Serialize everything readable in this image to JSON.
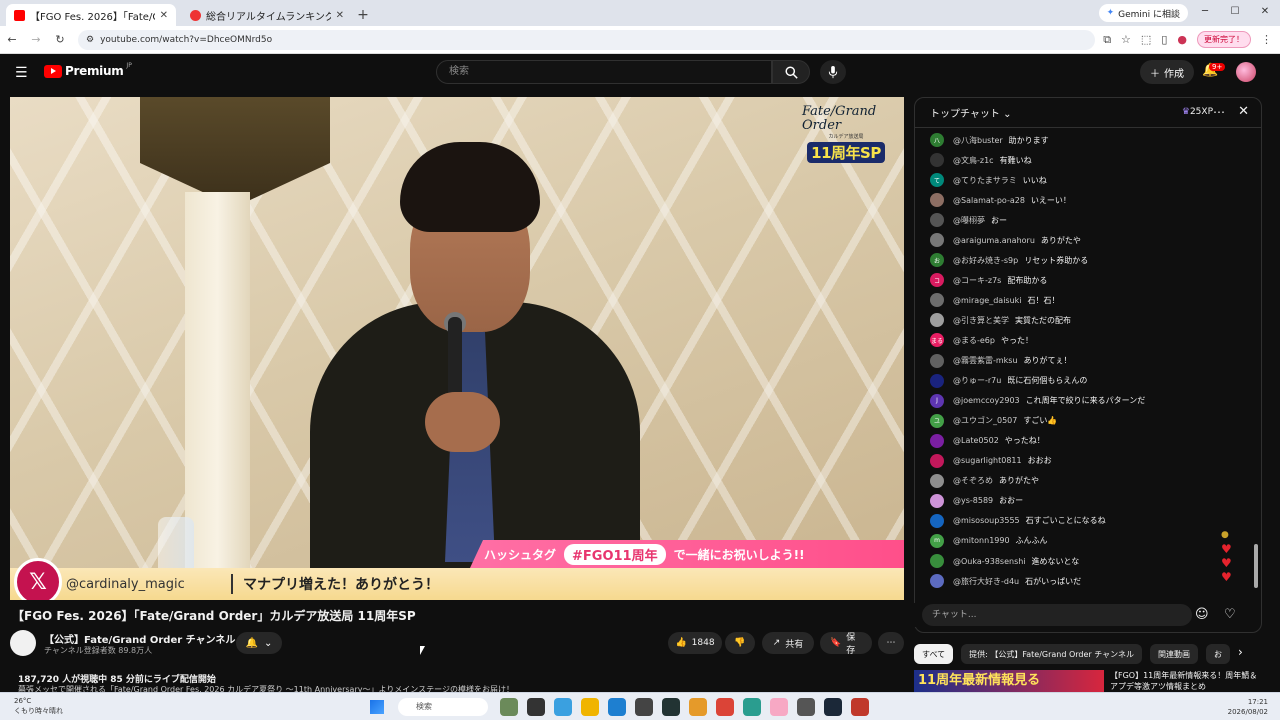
{
  "browser": {
    "tabs": [
      {
        "title": "【FGO Fes. 2026】「Fate/Gran",
        "active": true
      },
      {
        "title": "総合リアルタイムランキング | 配信ラ",
        "active": false
      }
    ],
    "gemini_label": "Gemini に相談",
    "url": "youtube.com/watch?v=DhceOMNrd5o",
    "restart_label": "更新完了！"
  },
  "youtube": {
    "logo_text": "Premium",
    "logo_region": "JP",
    "search_placeholder": "検索",
    "create_label": "作成",
    "notification_count": "9+"
  },
  "video": {
    "overlay_logo": {
      "line1": "Fate/Grand Order",
      "line2": "カルデア放送局",
      "line3": "11周年SP"
    },
    "hashtag_prefix": "ハッシュタグ",
    "hashtag": "#FGO11周年",
    "hashtag_suffix": "で一緒にお祝いしよう!!",
    "x_handle": "@cardinaly_magic",
    "x_message": "マナプリ増えた！ありがとう！"
  },
  "info": {
    "title": "【FGO Fes. 2026】「Fate/Grand Order」カルデア放送局 11周年SP",
    "channel_name": "【公式】Fate/Grand Order チャンネル",
    "subscribers": "チャンネル登録者数 89.8万人",
    "likes": "1848",
    "share_label": "共有",
    "save_label": "保存",
    "viewers": "187,720 人が視聴中  85 分前にライブ配信開始",
    "description": "幕張メッセで開催される「Fate/Grand Order Fes. 2026 カルデア夏祭り ～11th Anniversary～」よりメインステージの模様をお届け！"
  },
  "chat": {
    "header": "トップチャット",
    "xp": "25XP",
    "input_placeholder": "チャット...",
    "messages": [
      {
        "author": "@八海buster",
        "text": "助かります",
        "color": "#2e7d32",
        "initial": "八"
      },
      {
        "author": "@文鳥-z1c",
        "text": "有難いね",
        "color": "#333333",
        "initial": ""
      },
      {
        "author": "@てりたまサラミ",
        "text": "いいね",
        "color": "#00897b",
        "initial": "て"
      },
      {
        "author": "@Salamat-po-a28",
        "text": "いえーい！",
        "color": "#8d6e63",
        "initial": ""
      },
      {
        "author": "@曝栩夢",
        "text": "おー",
        "color": "#555555",
        "initial": ""
      },
      {
        "author": "@araiguma.anahoru",
        "text": "ありがたや",
        "color": "#777777",
        "initial": ""
      },
      {
        "author": "@お好み焼き-s9p",
        "text": "リセット券助かる",
        "color": "#2e7d32",
        "initial": "お"
      },
      {
        "author": "@コーキ-z7s",
        "text": "配布助かる",
        "color": "#d81b60",
        "initial": "コ"
      },
      {
        "author": "@mirage_daisuki",
        "text": "石！石！",
        "color": "#6d6d6d",
        "initial": ""
      },
      {
        "author": "@引き算と美学",
        "text": "実質ただの配布",
        "color": "#9e9e9e",
        "initial": ""
      },
      {
        "author": "@まる-e6p",
        "text": "やった！",
        "color": "#e91e63",
        "initial": "まる"
      },
      {
        "author": "@霧雲紫雷-mksu",
        "text": "ありがてぇ！",
        "color": "#616161",
        "initial": ""
      },
      {
        "author": "@りゅー-r7u",
        "text": "既に石何個もらえんの",
        "color": "#1a237e",
        "initial": ""
      },
      {
        "author": "@joemccoy2903",
        "text": "これ周年で絞りに来るパターンだ",
        "color": "#5e35b1",
        "initial": "J"
      },
      {
        "author": "@ユウゴン_0507",
        "text": "すごい👍",
        "color": "#43a047",
        "initial": "ユ"
      },
      {
        "author": "@Late0502",
        "text": "やったね！",
        "color": "#7b1fa2",
        "initial": ""
      },
      {
        "author": "@sugarlight0811",
        "text": "おおお",
        "color": "#c2185b",
        "initial": ""
      },
      {
        "author": "@そぞろめ",
        "text": "ありがたや",
        "color": "#8e8e8e",
        "initial": ""
      },
      {
        "author": "@ys-8589",
        "text": "おおー",
        "color": "#ce93d8",
        "initial": ""
      },
      {
        "author": "@misosoup3555",
        "text": "石すごいことになるね",
        "color": "#1565c0",
        "initial": ""
      },
      {
        "author": "@mitonn1990",
        "text": "ふんふん",
        "color": "#43a047",
        "initial": "m"
      },
      {
        "author": "@Ouka-938senshi",
        "text": "進めないとな",
        "color": "#388e3c",
        "initial": ""
      },
      {
        "author": "@旅行大好き-d4u",
        "text": "石がいっぱいだ",
        "color": "#5c6bc0",
        "initial": ""
      }
    ]
  },
  "chips": [
    {
      "label": "すべて",
      "on": true
    },
    {
      "label": "提供: 【公式】Fate/Grand Order チャンネル",
      "on": false
    },
    {
      "label": "関連動画",
      "on": false
    },
    {
      "label": "お",
      "on": false
    }
  ],
  "recommend": {
    "thumb_text": "11周年最新情報見る",
    "title": "【FGO】11周年最新情報来る！周年鯖＆アプデ等激アツ情報まとめ"
  },
  "taskbar": {
    "weather_temp": "26°C",
    "weather_desc": "くもり時々晴れ",
    "search_placeholder": "検索",
    "time": "17:21",
    "date": "2026/08/02"
  }
}
